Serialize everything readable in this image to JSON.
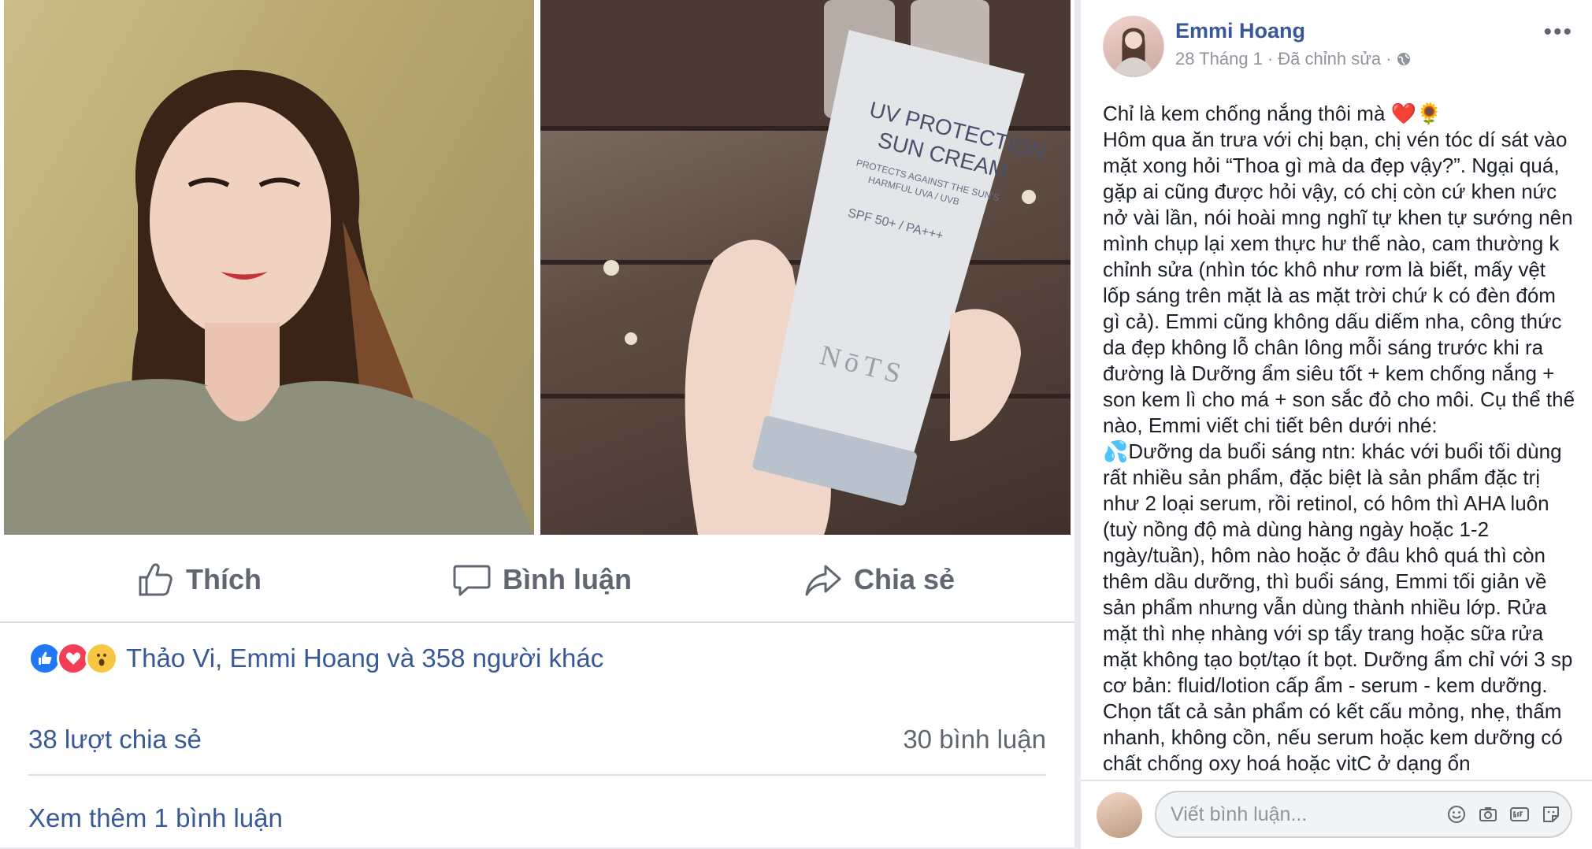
{
  "post": {
    "author": "Emmi Hoang",
    "date": "28 Tháng 1",
    "edited": "Đã chỉnh sửa",
    "separator": "·",
    "text": "Chỉ là kem chống nắng thôi mà ❤️🌻\nHôm qua ăn trưa với chị bạn, chị vén tóc dí sát vào mặt xong hỏi “Thoa gì mà da đẹp vậy?”. Ngại quá, gặp ai cũng được hỏi vậy, có chị còn cứ khen nức nở vài lần, nói hoài mng nghĩ tự khen tự sướng nên mình chụp lại xem thực hư thế nào, cam thường k chỉnh sửa (nhìn tóc khô như rơm là biết, mấy vệt lốp sáng trên mặt là as mặt trời chứ k có đèn đóm gì cả). Emmi cũng không dấu diếm nha, công thức da đẹp không lỗ chân lông mỗi sáng trước khi ra đường là Dưỡng ẩm siêu tốt + kem chống nắng + son kem lì cho má + son sắc đỏ cho môi. Cụ thể thế nào, Emmi viết chi tiết bên dưới nhé:\n💦Dưỡng da buổi sáng ntn: khác với buổi tối dùng rất nhiều sản phẩm, đặc biệt là sản phẩm đặc trị như 2 loại serum, rồi retinol, có hôm thì AHA luôn (tuỳ nồng độ mà dùng hàng ngày hoặc 1-2 ngày/tuần), hôm nào hoặc ở đâu khô quá thì còn thêm dầu dưỡng, thì buổi sáng, Emmi tối giản về sản phẩm nhưng vẫn dùng thành nhiều lớp. Rửa mặt thì nhẹ nhàng với sp tẩy trang hoặc sữa rửa mặt không tạo bọt/tạo ít bọt. Dưỡng ẩm chỉ với 3 sp cơ bản: fluid/lotion cấp ẩm - serum - kem dưỡng. Chọn tất cả sản phẩm có kết cấu mỏng, nhẹ, thấm nhanh, không cồn, nếu serum hoặc kem dưỡng có chất chống oxy hoá hoặc vitC ở dạng ổn"
  },
  "product": {
    "line1": "UV PROTECTION",
    "line2": "SUN CREAM",
    "line3": "PROTECTS AGAINST THE SUN'S",
    "line4": "HARMFUL UVA / UVB",
    "spf": "SPF 50+ / PA+++",
    "brand": "NōTS"
  },
  "actions": {
    "like": "Thích",
    "comment": "Bình luận",
    "share": "Chia sẻ"
  },
  "reactions": {
    "summary": "Thảo Vi, Emmi Hoang và 358 người khác"
  },
  "stats": {
    "shares": "38 lượt chia sẻ",
    "comments": "30 bình luận"
  },
  "more_comments": "Xem thêm 1 bình luận",
  "comment_box": {
    "placeholder": "Viết bình luận..."
  },
  "icons": {
    "menu": "more-options-icon",
    "privacy": "globe-icon",
    "like": "thumbs-up-icon",
    "comment": "speech-bubble-icon",
    "share": "share-arrow-icon",
    "emoji": "smiley-icon",
    "camera": "camera-icon",
    "gif": "gif-icon",
    "sticker": "sticker-icon"
  },
  "colors": {
    "link": "#385898",
    "muted": "#606770",
    "like_blue": "#2078f4",
    "love_red": "#f33e58",
    "wow_yellow": "#f7c744"
  }
}
